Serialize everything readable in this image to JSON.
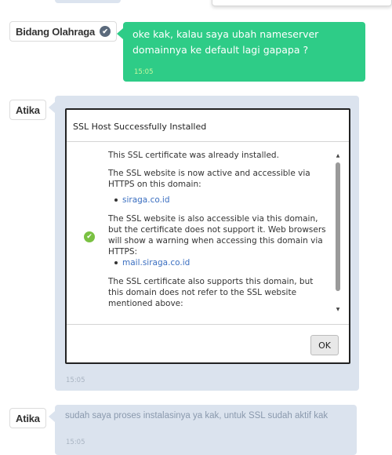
{
  "messages": [
    {
      "sender": "Bidang Olahraga",
      "verified_icon": "check-badge-icon",
      "text": "oke kak, kalau saya ubah nameserver domainnya ke default lagi gapapa ?",
      "time": "15:05",
      "color": "#2ecc87"
    },
    {
      "sender": "Atika",
      "time": "15:05",
      "color": "#dbe3ee",
      "attachment": {
        "dialog_title": "SSL Host Successfully Installed",
        "paragraph_1": "This SSL certificate was already installed.",
        "paragraph_2": "The SSL website is now active and accessible via HTTPS on this domain:",
        "domain_1": "siraga.co.id",
        "paragraph_3": "The SSL website is also accessible via this domain, but the certificate does not support it. Web browsers will show a warning when accessing this domain via HTTPS:",
        "domain_2": "mail.siraga.co.id",
        "paragraph_4": "The SSL certificate also supports this domain, but this domain does not refer to the SSL website mentioned above:",
        "ok_label": "OK",
        "status_icon": "success-check-icon"
      }
    },
    {
      "sender": "Atika",
      "text": "sudah saya proses instalasinya ya kak, untuk SSL sudah aktif kak",
      "time": "15:05",
      "color": "#dbe3ee"
    }
  ]
}
